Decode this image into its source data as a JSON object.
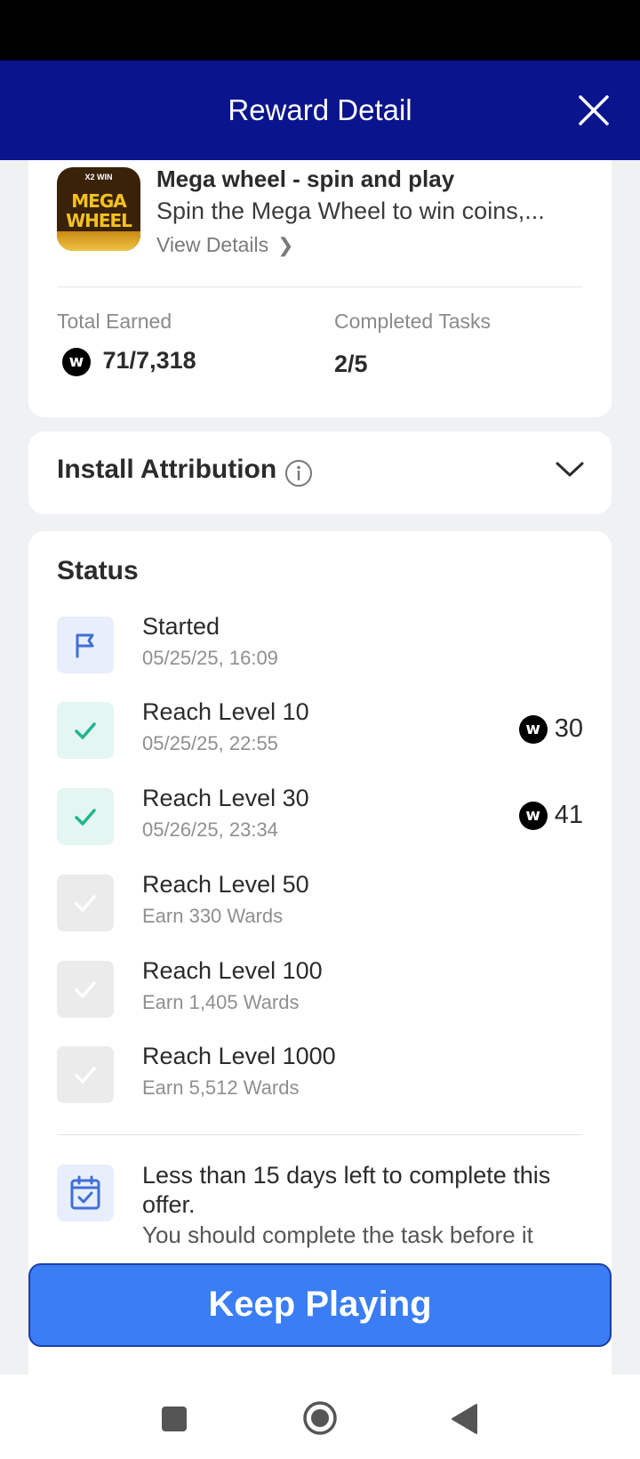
{
  "header": {
    "title": "Reward Detail"
  },
  "app": {
    "icon_top": "X2 WIN",
    "icon_line1": "MEGA",
    "icon_line2": "WHEEL",
    "name": "Mega wheel - spin and play",
    "description": "Spin the Mega Wheel to win coins,...",
    "view_details": "View Details"
  },
  "stats": {
    "total_earned_label": "Total Earned",
    "total_earned_value": "71/7,318",
    "completed_label": "Completed Tasks",
    "completed_value": "2/5",
    "coin_glyph": "w"
  },
  "attribution": {
    "title": "Install Attribution"
  },
  "status": {
    "title": "Status",
    "items": [
      {
        "title": "Started",
        "sub": "05/25/25, 16:09",
        "state": "started",
        "reward": ""
      },
      {
        "title": "Reach Level 10",
        "sub": "05/25/25, 22:55",
        "state": "done",
        "reward": "30"
      },
      {
        "title": "Reach Level 30",
        "sub": "05/26/25, 23:34",
        "state": "done",
        "reward": "41"
      },
      {
        "title": "Reach Level 50",
        "sub": "Earn 330 Wards",
        "state": "pending",
        "reward": ""
      },
      {
        "title": "Reach Level 100",
        "sub": "Earn 1,405 Wards",
        "state": "pending",
        "reward": ""
      },
      {
        "title": "Reach Level 1000",
        "sub": "Earn 5,512 Wards",
        "state": "pending",
        "reward": ""
      }
    ],
    "deadline": "Less than 15 days left to complete this offer.",
    "deadline_sub": "You should complete the task before it"
  },
  "cta": {
    "label": "Keep Playing"
  },
  "colors": {
    "header": "#0a148c",
    "accent": "#3a7df5",
    "done": "#1fb58f",
    "flag": "#3f6fd8"
  }
}
